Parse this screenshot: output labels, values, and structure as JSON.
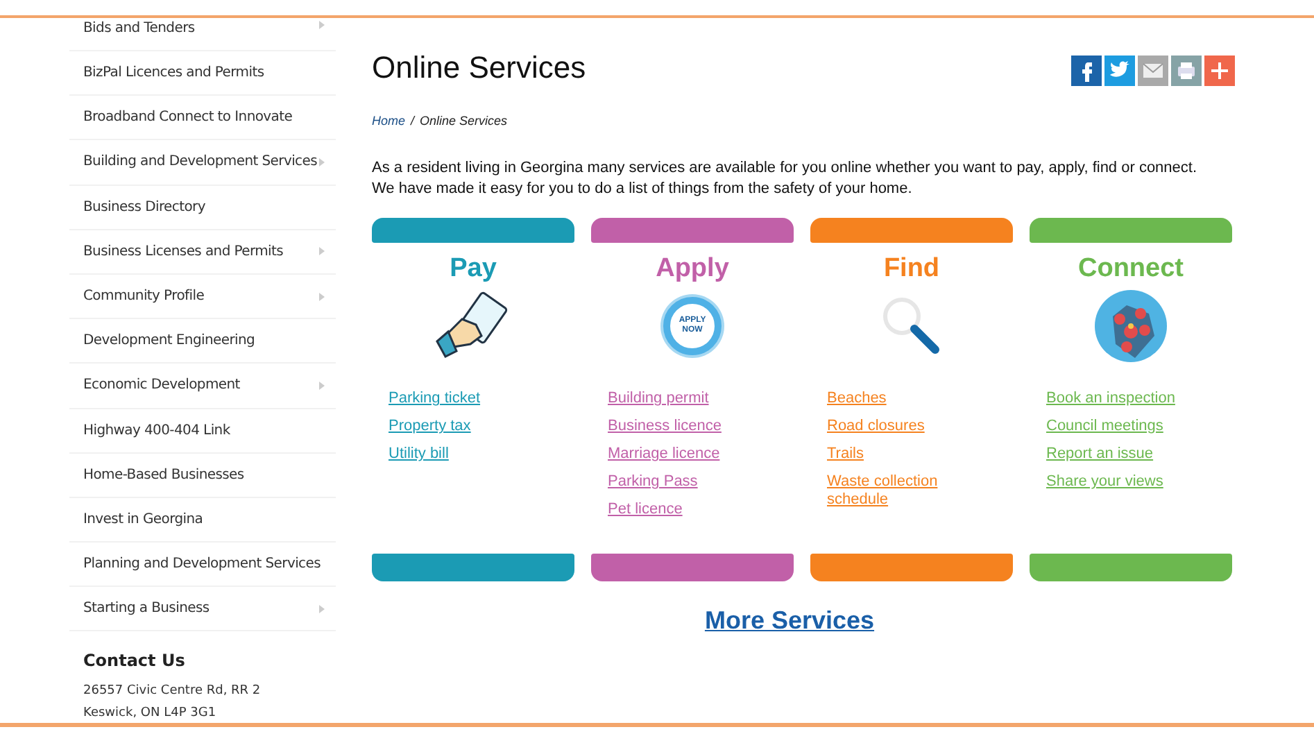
{
  "sidebar": {
    "items": [
      {
        "label": "Bids and Tenders",
        "has_submenu": true
      },
      {
        "label": "BizPal Licences and Permits",
        "has_submenu": false
      },
      {
        "label": "Broadband Connect to Innovate",
        "has_submenu": false
      },
      {
        "label": "Building and Development Services",
        "has_submenu": true
      },
      {
        "label": "Business Directory",
        "has_submenu": false
      },
      {
        "label": "Business Licenses and Permits",
        "has_submenu": true
      },
      {
        "label": "Community Profile",
        "has_submenu": true
      },
      {
        "label": "Development Engineering",
        "has_submenu": false
      },
      {
        "label": "Economic Development",
        "has_submenu": true
      },
      {
        "label": "Highway 400-404 Link",
        "has_submenu": false
      },
      {
        "label": "Home-Based Businesses",
        "has_submenu": false
      },
      {
        "label": "Invest in Georgina",
        "has_submenu": false
      },
      {
        "label": "Planning and Development Services",
        "has_submenu": false
      },
      {
        "label": "Starting a Business",
        "has_submenu": true
      }
    ],
    "contact": {
      "heading": "Contact Us",
      "lines": [
        "26557 Civic Centre Rd, RR 2",
        "Keswick, ON  L4P 3G1"
      ]
    }
  },
  "page": {
    "title": "Online Services",
    "share": [
      {
        "kind": "facebook"
      },
      {
        "kind": "twitter"
      },
      {
        "kind": "email"
      },
      {
        "kind": "print"
      },
      {
        "kind": "more"
      }
    ],
    "breadcrumb_separator": "/",
    "breadcrumb": [
      {
        "label": "Home",
        "link": true
      },
      {
        "label": "Online Services",
        "link": false
      }
    ],
    "intro": "As a resident living in Georgina many services are available for you online whether you want to pay, apply, find or connect. We have made it easy for you to do a list of things from the safety of your home.",
    "cards": [
      {
        "title": "Pay",
        "kind": "pay",
        "color": "#1b9bb4",
        "links": [
          "Parking ticket",
          "Property tax",
          "Utility bill"
        ]
      },
      {
        "title": "Apply",
        "kind": "apply",
        "color": "#c160a8",
        "badge": "APPLY NOW",
        "links": [
          "Building permit",
          "Business licence",
          "Marriage licence",
          "Parking Pass",
          "Pet licence"
        ]
      },
      {
        "title": "Find",
        "kind": "find",
        "color": "#f5821f",
        "links": [
          "Beaches",
          "Road closures",
          "Trails",
          "Waste collection schedule"
        ]
      },
      {
        "title": "Connect",
        "kind": "connect",
        "color": "#6cb84f",
        "links": [
          "Book an inspection",
          "Council meetings",
          "Report an issue",
          "Share your views"
        ]
      }
    ],
    "more_link": "More Services"
  }
}
